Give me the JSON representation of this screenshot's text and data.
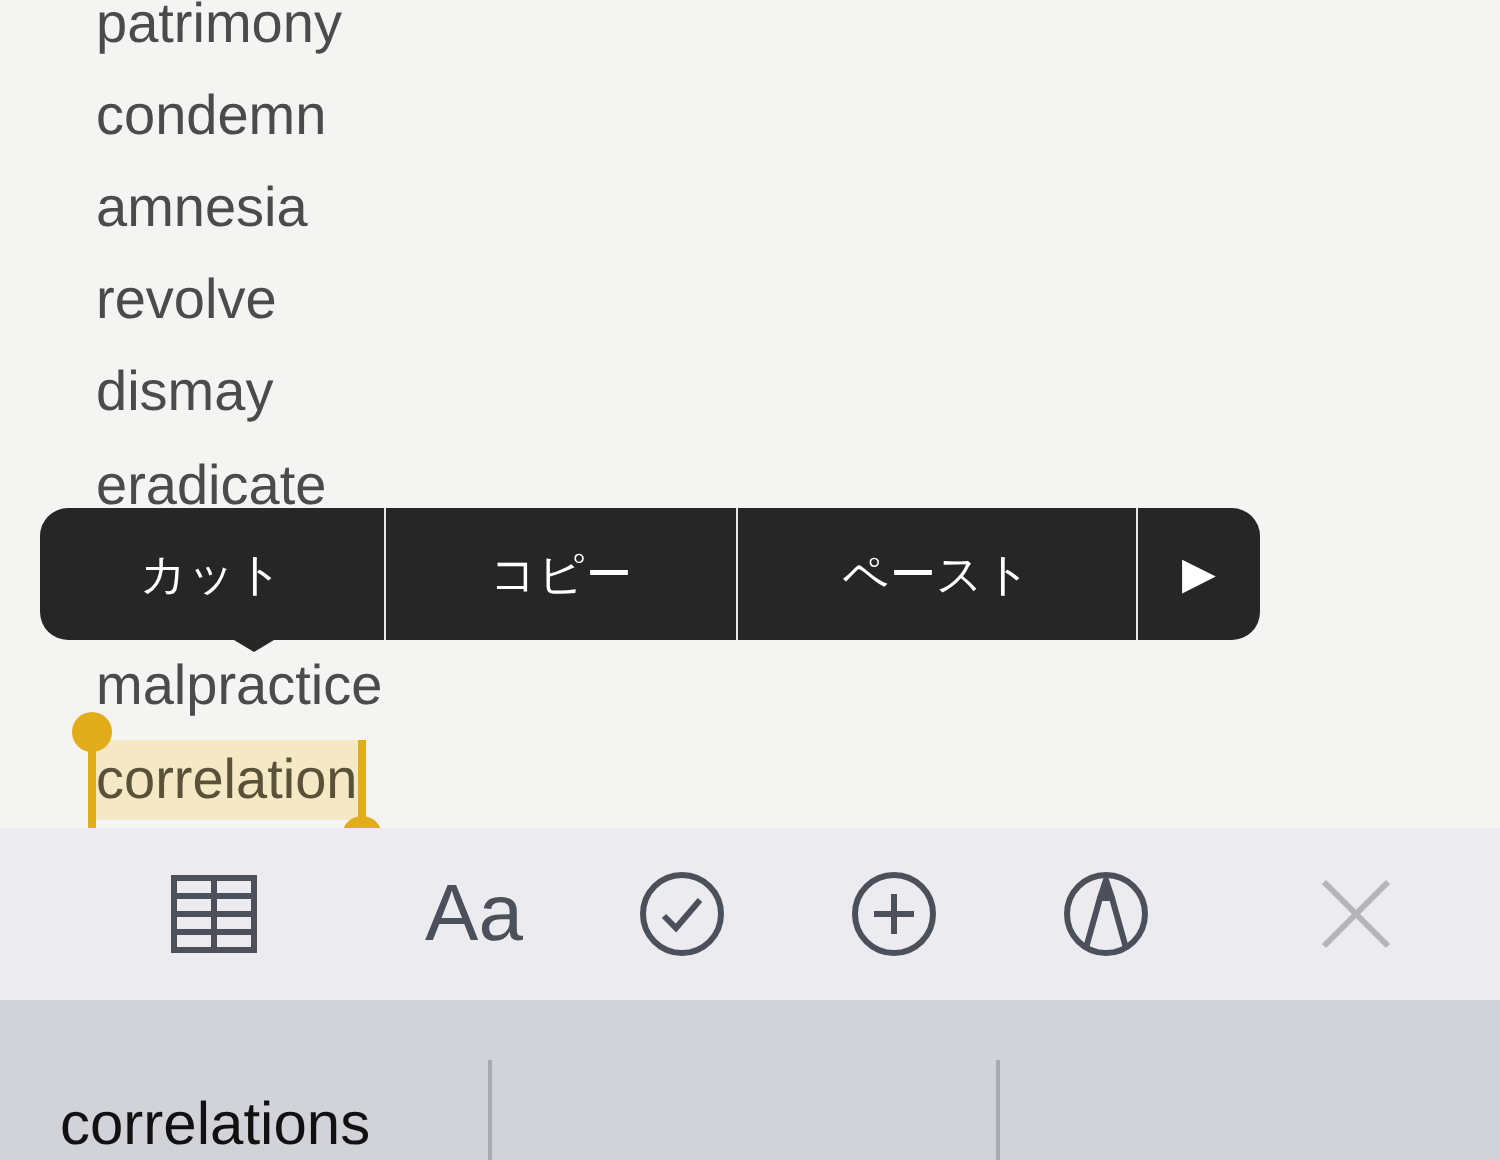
{
  "note_lines": [
    {
      "text": "patrimony",
      "selected": false
    },
    {
      "text": "condemn",
      "selected": false
    },
    {
      "text": "amnesia",
      "selected": false
    },
    {
      "text": "revolve",
      "selected": false
    },
    {
      "text": "dismay",
      "selected": false
    },
    {
      "text": "eradicate",
      "selected": false
    },
    {
      "text": "malpractice",
      "selected": false
    },
    {
      "text": "correlation",
      "selected": true
    }
  ],
  "edit_menu": [
    {
      "label": "カット"
    },
    {
      "label": "コピー"
    },
    {
      "label": "ペースト"
    },
    {
      "label": "▶"
    }
  ],
  "toolbar": [
    {
      "kind": "table",
      "disabled": false
    },
    {
      "kind": "format",
      "label": "Aa",
      "disabled": false
    },
    {
      "kind": "checklist",
      "disabled": false
    },
    {
      "kind": "add",
      "disabled": false
    },
    {
      "kind": "markup",
      "disabled": false
    },
    {
      "kind": "close",
      "disabled": true
    }
  ],
  "suggestions": [
    "correlations"
  ]
}
